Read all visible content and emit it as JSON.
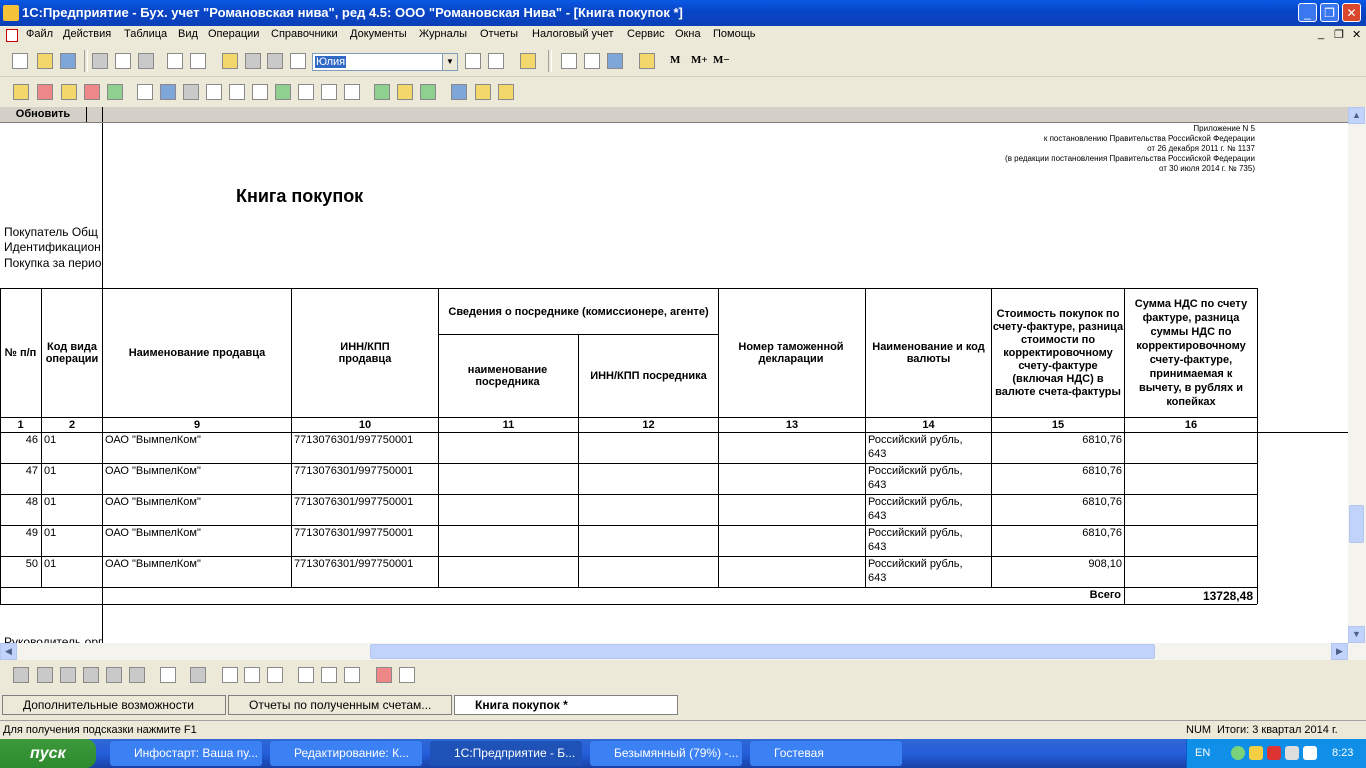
{
  "window": {
    "title": "1С:Предприятие - Бух. учет \"Романовская нива\", ред 4.5: ООО \"Романовская Нива\" - [Книга покупок  *]",
    "controls": [
      "_",
      "❐",
      "✕"
    ],
    "mdi_controls": [
      "_",
      "❐",
      "✕"
    ]
  },
  "menu": [
    "Файл",
    "Действия",
    "Таблица",
    "Вид",
    "Операции",
    "Справочники",
    "Документы",
    "Журналы",
    "Отчеты",
    "Налоговый учет",
    "Сервис",
    "Окна",
    "Помощь"
  ],
  "toolbar": {
    "user_combo_value": "Юлия",
    "calc_buttons": [
      "M",
      "M+",
      "M−"
    ]
  },
  "report": {
    "refresh_label": "Обновить",
    "appendix_lines": [
      "Приложение N 5",
      "к постановлению Правительства Российской Федерации",
      "от 26 декабря 2011 г. № 1137",
      "(в редакции постановления Правительства Российской Федерации",
      "от 30 июля 2014 г. № 735)"
    ],
    "title": "Книга покупок",
    "left_lines": [
      "Покупатель  Общ",
      "Идентификацион",
      "Покупка за перио"
    ],
    "footer_left": "Руководитель  орг",
    "headers": {
      "num": "№ п/п",
      "op_code": "Код вида операции",
      "seller": "Наименование продавца",
      "inn": "ИНН/КПП продавца",
      "intermediary_group": "Сведения о посреднике (комиссионере, агенте)",
      "intermediary_name": "наименование посредника",
      "intermediary_inn": "ИНН/КПП посредника",
      "customs": "Номер таможенной декларации",
      "currency": "Наименование и код валюты",
      "cost": "Стоимость покупок по счету-фактуре, разница стоимости по корректировочному счету-фактуре (включая НДС) в валюте счета-фактуры",
      "vat": "Сумма НДС по счету фактуре, разница суммы НДС по корректировочному счету-фактуре, принимаемая к вычету, в рублях и копейках"
    },
    "col_numbers": [
      "1",
      "2",
      "9",
      "10",
      "11",
      "12",
      "13",
      "14",
      "15",
      "16"
    ],
    "rows": [
      {
        "num": "46",
        "op": "01",
        "seller": "ОАО \"ВымпелКом\"",
        "inn": "7713076301/997750001",
        "currency_1": "Российский рубль,",
        "currency_2": "643",
        "cost": "6810,76"
      },
      {
        "num": "47",
        "op": "01",
        "seller": "ОАО \"ВымпелКом\"",
        "inn": "7713076301/997750001",
        "currency_1": "Российский рубль,",
        "currency_2": "643",
        "cost": "6810,76"
      },
      {
        "num": "48",
        "op": "01",
        "seller": "ОАО \"ВымпелКом\"",
        "inn": "7713076301/997750001",
        "currency_1": "Российский рубль,",
        "currency_2": "643",
        "cost": "6810,76"
      },
      {
        "num": "49",
        "op": "01",
        "seller": "ОАО \"ВымпелКом\"",
        "inn": "7713076301/997750001",
        "currency_1": "Российский рубль,",
        "currency_2": "643",
        "cost": "6810,76"
      },
      {
        "num": "50",
        "op": "01",
        "seller": "ОАО \"ВымпелКом\"",
        "inn": "7713076301/997750001",
        "currency_1": "Российский рубль,",
        "currency_2": "643",
        "cost": "908,10"
      }
    ],
    "total_label": "Всего",
    "total_value": "13728,48"
  },
  "window_tabs": [
    "Дополнительные возможности",
    "Отчеты по полученным счетам...",
    "Книга покупок  *"
  ],
  "status": {
    "hint": "Для получения подсказки нажмите F1",
    "num": "NUM",
    "period": "Итоги: 3 квартал 2014 г."
  },
  "taskbar": {
    "start": "пуск",
    "tasks": [
      "Инфостарт: Ваша пу...",
      "Редактирование: К...",
      "1С:Предприятие - Б...",
      "Безымянный (79%) -...",
      "Гостевая"
    ],
    "lang": "EN",
    "clock": "8:23"
  }
}
